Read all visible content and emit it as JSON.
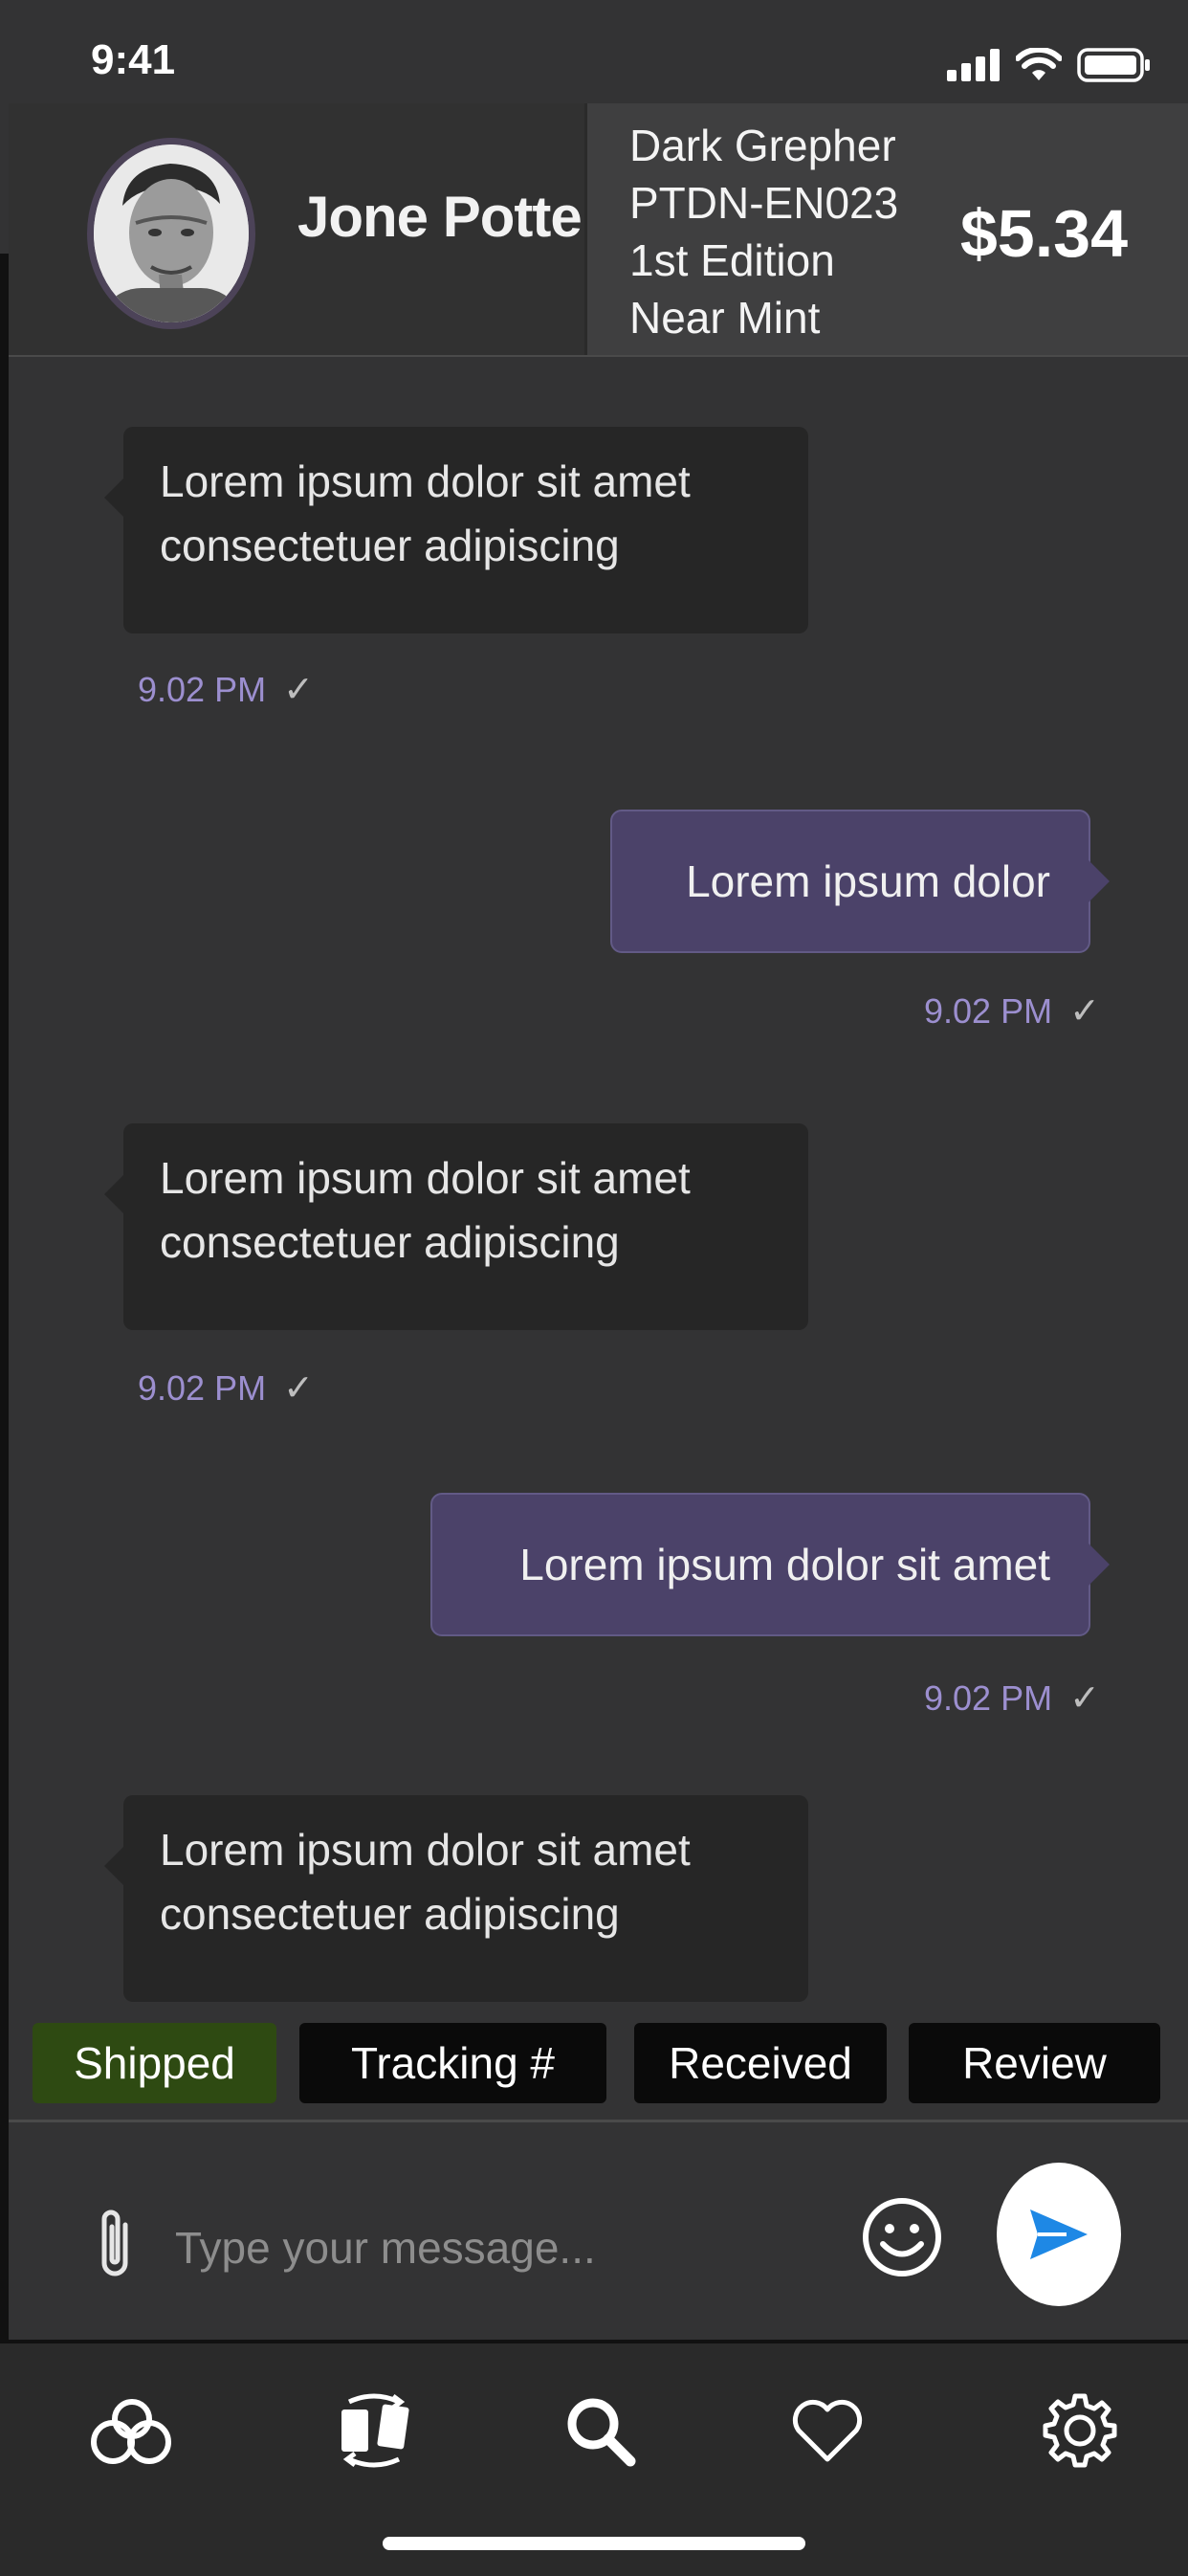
{
  "status_bar": {
    "time": "9:41"
  },
  "header": {
    "user_name": "Jone Potter",
    "product": {
      "name": "Dark Grepher",
      "code": "PTDN-EN023",
      "edition": "1st Edition",
      "condition": "Near Mint"
    },
    "price": "$5.34"
  },
  "messages": [
    {
      "direction": "incoming",
      "lines": [
        "Lorem ipsum dolor sit amet",
        "consectetuer adipiscing"
      ],
      "time": "9.02 PM"
    },
    {
      "direction": "outgoing",
      "lines": [
        "Lorem ipsum dolor"
      ],
      "time": "9.02 PM"
    },
    {
      "direction": "incoming",
      "lines": [
        "Lorem ipsum dolor sit amet",
        "consectetuer adipiscing"
      ],
      "time": "9.02 PM"
    },
    {
      "direction": "outgoing",
      "lines": [
        "Lorem ipsum dolor sit amet"
      ],
      "time": "9.02 PM"
    },
    {
      "direction": "incoming",
      "lines": [
        "Lorem ipsum dolor sit amet",
        "consectetuer adipiscing"
      ],
      "time": ""
    }
  ],
  "status_chips": [
    {
      "label": "Shipped",
      "active": true
    },
    {
      "label": "Tracking #",
      "active": false
    },
    {
      "label": "Received",
      "active": false
    },
    {
      "label": "Review",
      "active": false
    }
  ],
  "composer": {
    "placeholder": "Type your message..."
  },
  "nav": [
    "link-icon",
    "trade-icon",
    "search-icon",
    "heart-icon",
    "gear-icon"
  ],
  "colors": {
    "background": "#333334",
    "incoming_bubble": "#262626",
    "outgoing_bubble": "#4b4269",
    "timestamp": "#9c8fcf",
    "shipped_chip": "#2e4a12"
  }
}
